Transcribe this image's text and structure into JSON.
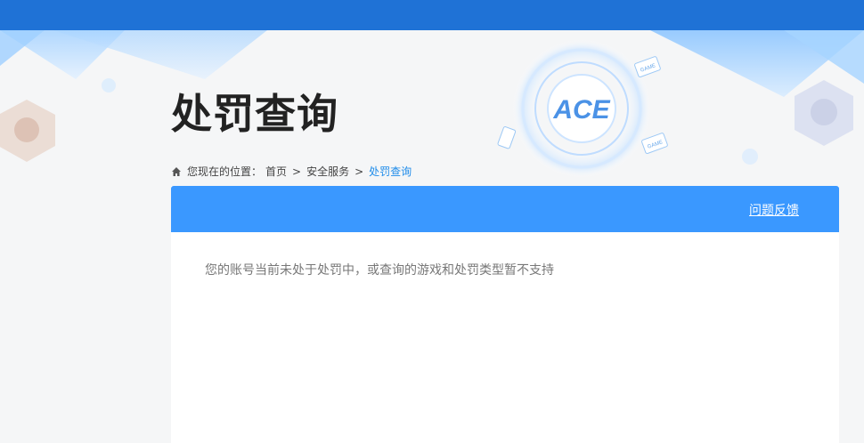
{
  "page": {
    "title": "处罚查询"
  },
  "breadcrumb": {
    "prefix": "您现在的位置：",
    "items": [
      "首页",
      "安全服务"
    ],
    "separator": ">",
    "current": "处罚查询"
  },
  "panel": {
    "feedback_label": "问题反馈",
    "message": "您的账号当前未处于处罚中，或查询的游戏和处罚类型暂不支持"
  },
  "decor": {
    "logo_text": "ACE",
    "badge_text": "GAME"
  },
  "colors": {
    "top_bar": "#1f72d6",
    "panel_header": "#3a98ff",
    "breadcrumb_current": "#1f8cea",
    "background": "#f5f6f7"
  }
}
